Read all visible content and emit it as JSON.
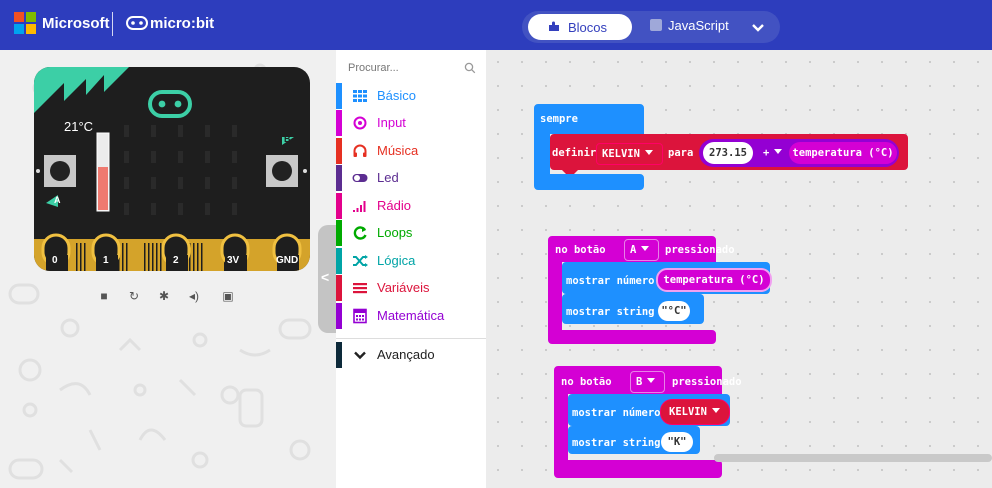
{
  "header": {
    "brand": "Microsoft",
    "product": "micro:bit",
    "tabs": [
      {
        "label": "Blocos",
        "active": true
      },
      {
        "label": "JavaScript",
        "active": false
      }
    ],
    "bar_color": "#2d3dbd"
  },
  "simulator": {
    "temperature_label": "21°C",
    "button_a": "A",
    "button_b": "B",
    "pins": [
      "0",
      "1",
      "2",
      "3V",
      "GND"
    ],
    "controls": [
      "stop-icon",
      "restart-icon",
      "debug-icon",
      "sound-icon",
      "fullscreen-icon"
    ]
  },
  "toolbox": {
    "search_placeholder": "Procurar...",
    "categories": [
      {
        "label": "Básico",
        "color": "#1e90ff",
        "icon": "grid-icon"
      },
      {
        "label": "Input",
        "color": "#d400d4",
        "icon": "target-icon"
      },
      {
        "label": "Música",
        "color": "#e63022",
        "icon": "headphones-icon"
      },
      {
        "label": "Led",
        "color": "#5c2d91",
        "icon": "toggle-icon"
      },
      {
        "label": "Rádio",
        "color": "#e3008c",
        "icon": "signal-icon"
      },
      {
        "label": "Loops",
        "color": "#00aa00",
        "icon": "loop-icon"
      },
      {
        "label": "Lógica",
        "color": "#00a4a6",
        "icon": "shuffle-icon"
      },
      {
        "label": "Variáveis",
        "color": "#dc143c",
        "icon": "list-icon"
      },
      {
        "label": "Matemática",
        "color": "#9400d3",
        "icon": "calculator-icon"
      }
    ],
    "advanced": {
      "label": "Avançado",
      "color": "#0d2a3a"
    }
  },
  "workspace": {
    "forever_block": {
      "label": "sempre",
      "statement": {
        "keyword": "definir",
        "variable": "KELVIN",
        "to_label": "para",
        "value": "273.15",
        "operator": "+",
        "sensor": "temperatura (°C)"
      }
    },
    "button_a_block": {
      "prefix": "no botão",
      "button": "A",
      "suffix": "pressionado",
      "show_number_label": "mostrar número",
      "show_number_value": "temperatura (°C)",
      "show_string_label": "mostrar string",
      "show_string_value": "\"°C\""
    },
    "button_b_block": {
      "prefix": "no botão",
      "button": "B",
      "suffix": "pressionado",
      "show_number_label": "mostrar número",
      "show_number_value": "KELVIN",
      "show_string_label": "mostrar string",
      "show_string_value": "\"K\""
    }
  }
}
